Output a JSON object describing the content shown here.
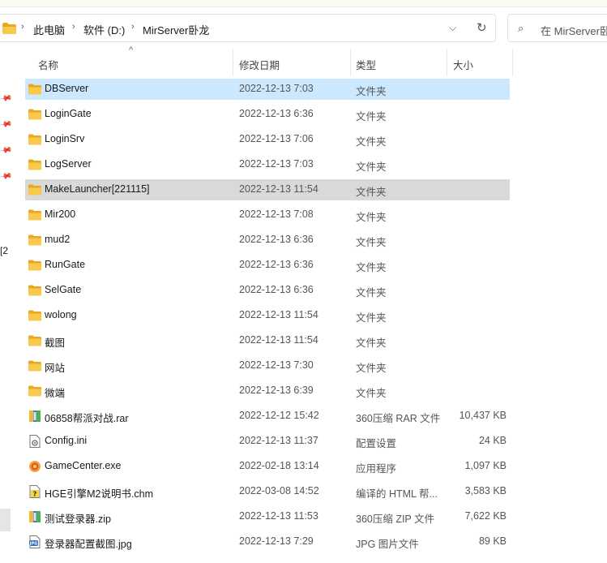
{
  "address_bar": {
    "breadcrumbs": [
      "此电脑",
      "软件 (D:)",
      "MirServer卧龙"
    ]
  },
  "search": {
    "placeholder": "在 MirServer卧"
  },
  "left_pane": {
    "truncated_label": "[2"
  },
  "columns": {
    "name": "名称",
    "date": "修改日期",
    "type": "类型",
    "size": "大小"
  },
  "files": [
    {
      "name": "DBServer",
      "date": "2022-12-13 7:03",
      "type": "文件夹",
      "size": "",
      "icon": "folder-icon",
      "state": "selected"
    },
    {
      "name": "LoginGate",
      "date": "2022-12-13 6:36",
      "type": "文件夹",
      "size": "",
      "icon": "folder-icon",
      "state": ""
    },
    {
      "name": "LoginSrv",
      "date": "2022-12-13 7:06",
      "type": "文件夹",
      "size": "",
      "icon": "folder-icon",
      "state": ""
    },
    {
      "name": "LogServer",
      "date": "2022-12-13 7:03",
      "type": "文件夹",
      "size": "",
      "icon": "folder-icon",
      "state": ""
    },
    {
      "name": "MakeLauncher[221115]",
      "date": "2022-12-13 11:54",
      "type": "文件夹",
      "size": "",
      "icon": "folder-icon",
      "state": "hover"
    },
    {
      "name": "Mir200",
      "date": "2022-12-13 7:08",
      "type": "文件夹",
      "size": "",
      "icon": "folder-icon",
      "state": ""
    },
    {
      "name": "mud2",
      "date": "2022-12-13 6:36",
      "type": "文件夹",
      "size": "",
      "icon": "folder-icon",
      "state": ""
    },
    {
      "name": "RunGate",
      "date": "2022-12-13 6:36",
      "type": "文件夹",
      "size": "",
      "icon": "folder-icon",
      "state": ""
    },
    {
      "name": "SelGate",
      "date": "2022-12-13 6:36",
      "type": "文件夹",
      "size": "",
      "icon": "folder-icon",
      "state": ""
    },
    {
      "name": "wolong",
      "date": "2022-12-13 11:54",
      "type": "文件夹",
      "size": "",
      "icon": "folder-icon",
      "state": ""
    },
    {
      "name": "截图",
      "date": "2022-12-13 11:54",
      "type": "文件夹",
      "size": "",
      "icon": "folder-icon",
      "state": ""
    },
    {
      "name": "网站",
      "date": "2022-12-13 7:30",
      "type": "文件夹",
      "size": "",
      "icon": "folder-icon",
      "state": ""
    },
    {
      "name": "微端",
      "date": "2022-12-13 6:39",
      "type": "文件夹",
      "size": "",
      "icon": "folder-icon",
      "state": ""
    },
    {
      "name": "06858帮派对战.rar",
      "date": "2022-12-12 15:42",
      "type": "360压缩 RAR 文件",
      "size": "10,437 KB",
      "icon": "archive-icon",
      "state": ""
    },
    {
      "name": "Config.ini",
      "date": "2022-12-13 11:37",
      "type": "配置设置",
      "size": "24 KB",
      "icon": "ini-file-icon",
      "state": ""
    },
    {
      "name": "GameCenter.exe",
      "date": "2022-02-18 13:14",
      "type": "应用程序",
      "size": "1,097 KB",
      "icon": "exe-icon",
      "state": ""
    },
    {
      "name": "HGE引擎M2说明书.chm",
      "date": "2022-03-08 14:52",
      "type": "编译的 HTML 帮...",
      "size": "3,583 KB",
      "icon": "help-file-icon",
      "state": ""
    },
    {
      "name": "测试登录器.zip",
      "date": "2022-12-13 11:53",
      "type": "360压缩 ZIP 文件",
      "size": "7,622 KB",
      "icon": "archive-icon",
      "state": ""
    },
    {
      "name": "登录器配置截图.jpg",
      "date": "2022-12-13 7:29",
      "type": "JPG 图片文件",
      "size": "89 KB",
      "icon": "image-file-icon",
      "state": ""
    }
  ],
  "colors": {
    "selected_row": "#cce8ff",
    "hover_row": "#d9d9d9",
    "folder": "#f5c342"
  }
}
